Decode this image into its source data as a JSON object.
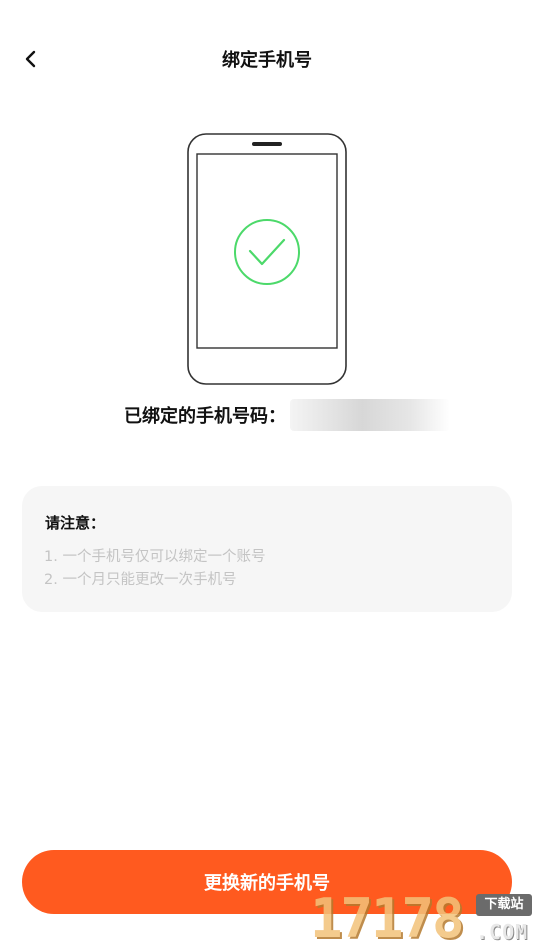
{
  "header": {
    "title": "绑定手机号",
    "back_icon": "chevron-left-icon"
  },
  "illustration": {
    "icon": "phone-check-icon",
    "check_color": "#4cd96a",
    "outline_color": "#333333"
  },
  "binding": {
    "label": "已绑定的手机号码：",
    "value": ""
  },
  "notice": {
    "title": "请注意：",
    "items": [
      "1. 一个手机号仅可以绑定一个账号",
      "2. 一个月只能更改一次手机号"
    ]
  },
  "actions": {
    "change_phone_label": "更换新的手机号"
  },
  "colors": {
    "primary": "#ff5a1f",
    "card_bg": "#f6f6f6",
    "hint_text": "#c4c4c4"
  },
  "watermark": {
    "digits": "17178",
    "tag": "下载站",
    "domain": ".COM"
  }
}
